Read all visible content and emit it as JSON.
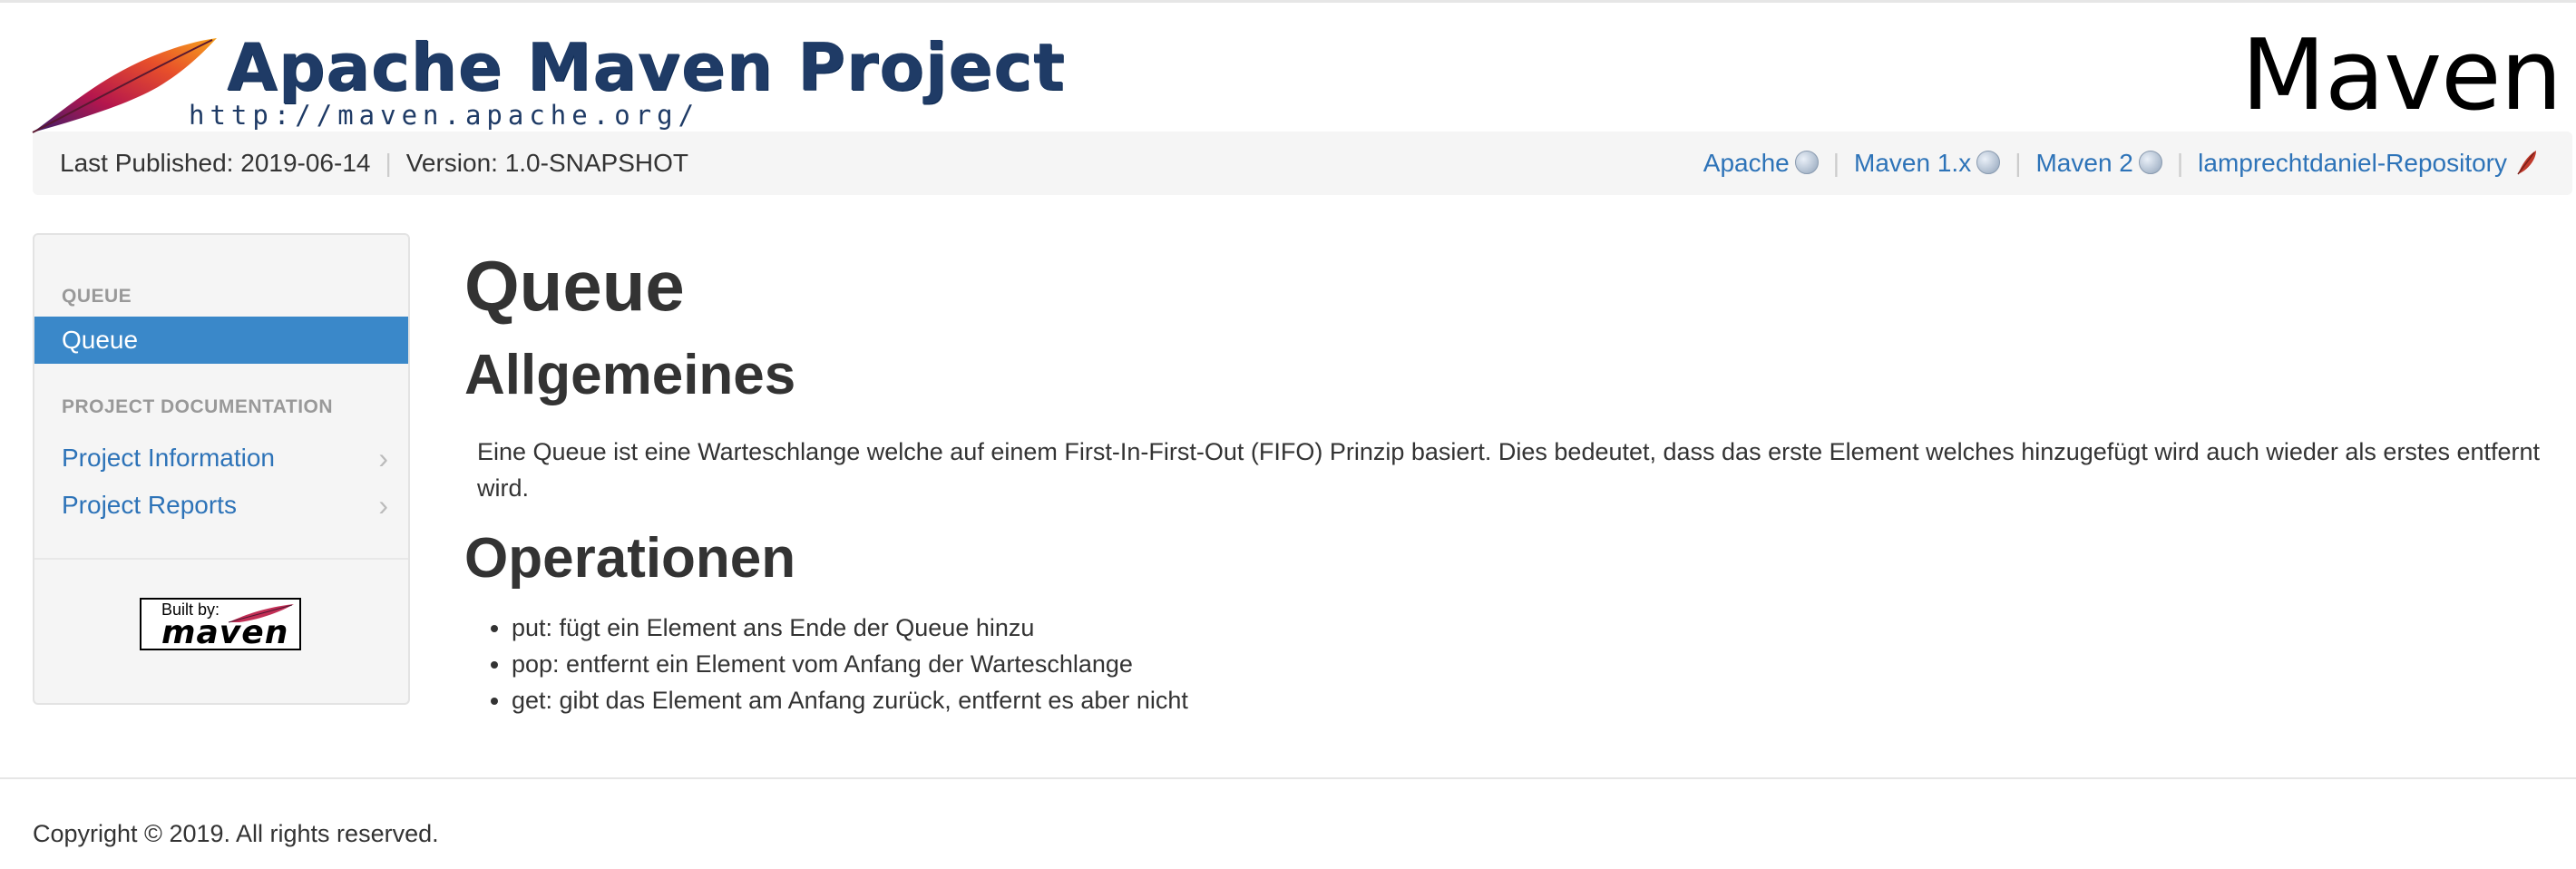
{
  "header": {
    "logo_title": "Apache Maven Project",
    "logo_url": "http://maven.apache.org/",
    "brand_right": "Maven"
  },
  "breadcrumb": {
    "published": "Last Published: 2019-06-14",
    "version": "Version: 1.0-SNAPSHOT",
    "links": [
      {
        "label": "Apache",
        "icon": "globe-icon"
      },
      {
        "label": "Maven 1.x",
        "icon": "globe-icon"
      },
      {
        "label": "Maven 2",
        "icon": "globe-icon"
      },
      {
        "label": "lamprechtdaniel-Repository",
        "icon": "feather-icon"
      }
    ]
  },
  "sidebar": {
    "section1_header": "QUEUE",
    "active_item": "Queue",
    "section2_header": "PROJECT DOCUMENTATION",
    "items": [
      {
        "label": "Project Information"
      },
      {
        "label": "Project Reports"
      }
    ],
    "built_by_small": "Built by:",
    "built_by_maven": "maven"
  },
  "main": {
    "title": "Queue",
    "section1_title": "Allgemeines",
    "paragraph": "Eine Queue ist eine Warteschlange welche auf einem First-In-First-Out (FIFO) Prinzip basiert. Dies bedeutet, dass das erste Element welches hinzugefügt wird auch wieder als erstes entfernt wird.",
    "section2_title": "Operationen",
    "operations": [
      "put: fügt ein Element ans Ende der Queue hinzu",
      "pop: entfernt ein Element vom Anfang der Warteschlange",
      "get: gibt das Element am Anfang zurück, entfernt es aber nicht"
    ]
  },
  "footer": {
    "copyright": "Copyright © 2019. All rights reserved."
  },
  "colors": {
    "link": "#2d73b8",
    "active": "#3a88c9",
    "logo": "#1f3b66"
  }
}
